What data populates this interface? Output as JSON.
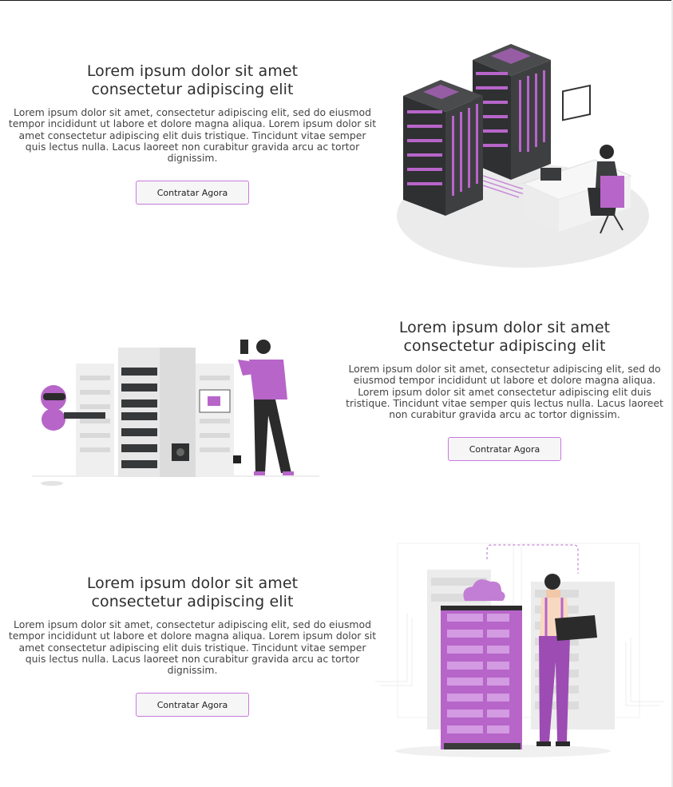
{
  "sections": [
    {
      "title": "Lorem ipsum dolor sit amet consectetur adipiscing elit",
      "body": "Lorem ipsum dolor sit amet, consectetur adipiscing elit, sed do eiusmod tempor incididunt ut labore et dolore magna aliqua. Lorem ipsum dolor sit amet consectetur adipiscing elit duis tristique. Tincidunt vitae semper quis lectus nulla. Lacus laoreet non curabitur gravida arcu ac tortor dignissim.",
      "button": "Contratar Agora",
      "illustration": "server-room-workstation-illustration"
    },
    {
      "title": "Lorem ipsum dolor sit amet consectetur adipiscing elit",
      "body": "Lorem ipsum dolor sit amet, consectetur adipiscing elit, sed do eiusmod tempor incididunt ut labore et dolore magna aliqua. Lorem ipsum dolor sit amet consectetur adipiscing elit duis tristique. Tincidunt vitae semper quis lectus nulla. Lacus laoreet non curabitur gravida arcu ac tortor dignissim.",
      "button": "Contratar Agora",
      "illustration": "robot-server-technician-illustration"
    },
    {
      "title": "Lorem ipsum dolor sit amet consectetur adipiscing elit",
      "body": "Lorem ipsum dolor sit amet, consectetur adipiscing elit, sed do eiusmod tempor incididunt ut labore et dolore magna aliqua. Lorem ipsum dolor sit amet consectetur adipiscing elit duis tristique. Tincidunt vitae semper quis lectus nulla. Lacus laoreet non curabitur gravida arcu ac tortor dignissim.",
      "button": "Contratar Agora",
      "illustration": "cloud-server-laptop-illustration"
    }
  ],
  "colors": {
    "accent": "#b765c9",
    "accent_dark": "#8e3fa4",
    "rack_dark": "#37383a",
    "light_gray": "#ebebeb",
    "text": "#2e2e2e"
  }
}
